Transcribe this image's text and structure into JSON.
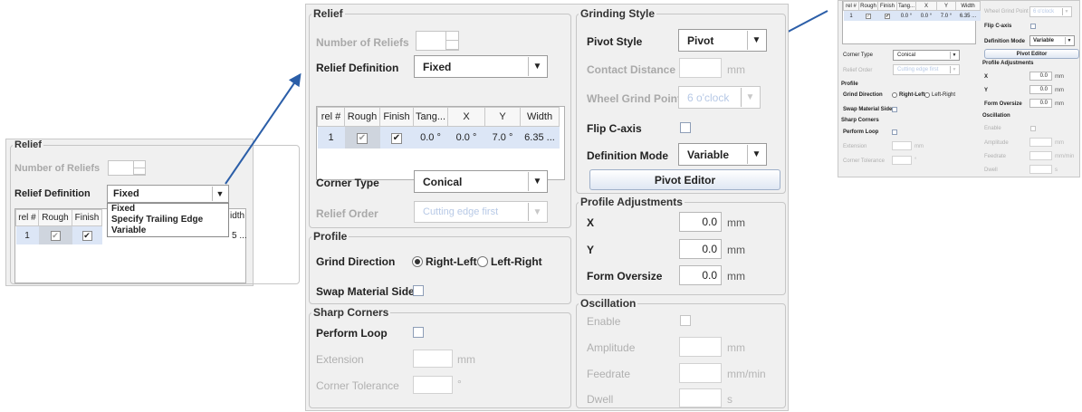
{
  "small": {
    "group_title": "Relief",
    "num_reliefs_label": "Number of Reliefs",
    "relief_def_label": "Relief Definition",
    "relief_def_value": "Fixed",
    "headers": [
      "rel #",
      "Rough",
      "Finish",
      "idth"
    ],
    "row": {
      "rel": "1",
      "tail": "5 ..."
    },
    "dropdown_options": [
      "Fixed",
      "Specify Trailing Edge",
      "Variable"
    ]
  },
  "main": {
    "relief": {
      "title": "Relief",
      "num_reliefs_label": "Number of Reliefs",
      "relief_def_label": "Relief Definition",
      "relief_def_value": "Fixed",
      "headers": [
        "rel #",
        "Rough",
        "Finish",
        "Tang...",
        "X",
        "Y",
        "Width"
      ],
      "row": {
        "rel": "1",
        "tang": "0.0 °",
        "x": "0.0 °",
        "y": "7.0 °",
        "width": "6.35 ..."
      },
      "corner_type_label": "Corner Type",
      "corner_type_value": "Conical",
      "relief_order_label": "Relief Order",
      "relief_order_value": "Cutting edge first"
    },
    "profile": {
      "title": "Profile",
      "grind_direction_label": "Grind Direction",
      "right_left": "Right-Left",
      "left_right": "Left-Right",
      "swap_label": "Swap Material Side"
    },
    "sharp": {
      "title": "Sharp Corners",
      "perform_loop_label": "Perform Loop",
      "extension_label": "Extension",
      "extension_unit": "mm",
      "tolerance_label": "Corner Tolerance",
      "tolerance_unit": "°"
    },
    "grinding": {
      "title": "Grinding Style",
      "pivot_style_label": "Pivot Style",
      "pivot_style_value": "Pivot",
      "contact_label": "Contact Distance",
      "contact_unit": "mm",
      "wheel_point_label": "Wheel Grind Point",
      "wheel_point_value": "6 o'clock",
      "flip_label": "Flip C-axis",
      "def_mode_label": "Definition Mode",
      "def_mode_value": "Variable",
      "pivot_editor_button": "Pivot Editor"
    },
    "profile_adj": {
      "title": "Profile Adjustments",
      "x_label": "X",
      "x_value": "0.0",
      "x_unit": "mm",
      "y_label": "Y",
      "y_value": "0.0",
      "y_unit": "mm",
      "form_label": "Form Oversize",
      "form_value": "0.0",
      "form_unit": "mm"
    },
    "oscillation": {
      "title": "Oscillation",
      "enable_label": "Enable",
      "amplitude_label": "Amplitude",
      "amplitude_unit": "mm",
      "feedrate_label": "Feedrate",
      "feedrate_unit": "mm/min",
      "dwell_label": "Dwell",
      "dwell_unit": "s"
    }
  },
  "thumb": {
    "headers": [
      "rel #",
      "Rough",
      "Finish",
      "Tang...",
      "X",
      "Y",
      "Width"
    ],
    "row": {
      "rel": "1",
      "tang": "0.0 °",
      "x": "0.0 °",
      "y": "7.0 °",
      "width": "6.35 ..."
    },
    "corner_type_label": "Corner Type",
    "corner_type_value": "Conical",
    "relief_order_label": "Relief Order",
    "relief_order_value": "Cutting edge first",
    "profile_title": "Profile",
    "grind_direction_label": "Grind Direction",
    "right_left": "Right-Left",
    "left_right": "Left-Right",
    "swap_label": "Swap Material Side",
    "sharp_title": "Sharp Corners",
    "perform_loop_label": "Perform Loop",
    "extension_label": "Extension",
    "extension_unit": "mm",
    "tolerance_label": "Corner Tolerance",
    "tolerance_unit": "°",
    "wheel_point_label": "Wheel Grind Point",
    "wheel_point_value": "6 o'clock",
    "flip_label": "Flip C-axis",
    "def_mode_label": "Definition Mode",
    "def_mode_value": "Variable",
    "pivot_editor_button": "Pivot Editor",
    "profile_adj_title": "Profile Adjustments",
    "x_label": "X",
    "x_value": "0.0",
    "x_unit": "mm",
    "y_label": "Y",
    "y_value": "0.0",
    "y_unit": "mm",
    "form_label": "Form Oversize",
    "form_value": "0.0",
    "form_unit": "mm",
    "osc_title": "Oscillation",
    "enable_label": "Enable",
    "amplitude_label": "Amplitude",
    "amplitude_unit": "mm",
    "feedrate_label": "Feedrate",
    "feedrate_unit": "mm/min",
    "dwell_label": "Dwell",
    "dwell_unit": "s"
  },
  "colors": {
    "arrow": "#2b5ea8",
    "selection": "#dce6f6",
    "disabled_text": "#a9a9a9"
  },
  "icons": {
    "dropdown": "chevron-down-icon",
    "check": "checkmark-icon",
    "arrow": "callout-arrow-icon"
  }
}
